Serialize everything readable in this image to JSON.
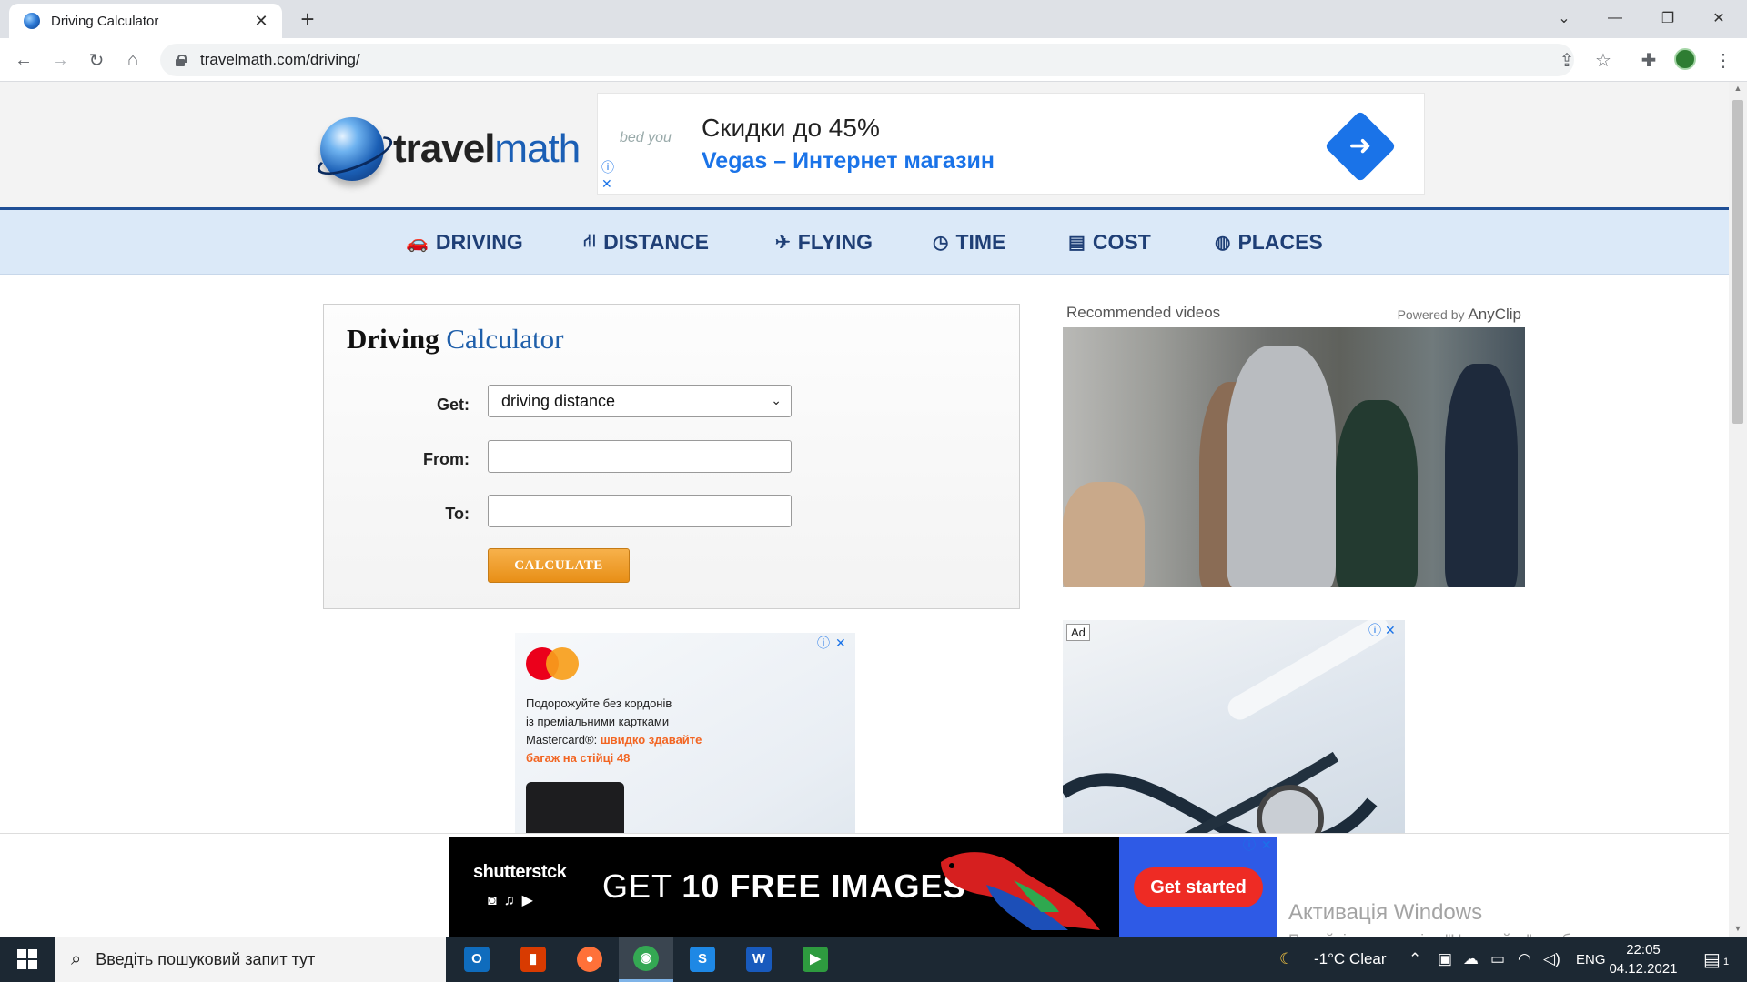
{
  "browser": {
    "tab_title": "Driving Calculator",
    "tab_close": "✕",
    "new_tab": "+",
    "url": "travelmath.com/driving/",
    "window_controls": [
      "⌄",
      "—",
      "❐",
      "✕"
    ]
  },
  "site": {
    "logo_word_bold": "travel",
    "logo_word_light": "math",
    "top_ad": {
      "brand": "bed you",
      "headline": "Скидки до 45%",
      "subline": "Vegas – Интернет магазин",
      "info": "ⓘ",
      "close": "✕"
    },
    "nav": [
      {
        "icon": "car-icon",
        "glyph": "🚗",
        "label": "DRIVING"
      },
      {
        "icon": "road-icon",
        "glyph": "⛙",
        "label": "DISTANCE"
      },
      {
        "icon": "plane-icon",
        "glyph": "✈",
        "label": "FLYING"
      },
      {
        "icon": "clock-icon",
        "glyph": "◷",
        "label": "TIME"
      },
      {
        "icon": "credit-card-icon",
        "glyph": "▤",
        "label": "COST"
      },
      {
        "icon": "globe-icon",
        "glyph": "◍",
        "label": "PLACES"
      }
    ]
  },
  "calculator": {
    "title_bold": "Driving",
    "title_light": "Calculator",
    "get_label": "Get:",
    "get_value": "driving distance",
    "from_label": "From:",
    "from_value": "",
    "to_label": "To:",
    "to_value": "",
    "button": "CALCULATE"
  },
  "videos": {
    "label": "Recommended videos",
    "powered_prefix": "Powered by",
    "powered_brand": "AnyClip"
  },
  "ad_mastercard": {
    "line1": "Подорожуйте без кордонів",
    "line2": "із преміальними картками",
    "line3": "Mastercard®:",
    "line3_orange": "швидко здавайте",
    "line4_orange": "багаж на стійці 48"
  },
  "ad_medical": {
    "tag": "Ad"
  },
  "ad_shutterstock": {
    "brand": "shutterstck",
    "icons": "◙♫▶",
    "headline_pre": "GET",
    "headline_num": "10",
    "headline_post": "FREE IMAGES",
    "cta": "Get started"
  },
  "watermark": {
    "title": "Активація Windows",
    "body": "Перейдіть до розділу \"Настройки\", щоб активувати Windows."
  },
  "taskbar": {
    "search_placeholder": "Введіть пошуковий запит тут",
    "weather": "-1°C  Clear",
    "lang": "ENG",
    "time": "22:05",
    "date": "04.12.2021",
    "notif_count": "1",
    "apps": [
      {
        "name": "outlook-app",
        "letter": "O",
        "color": "#0f6cbd"
      },
      {
        "name": "office-app",
        "letter": "▮",
        "color": "#d83b01"
      },
      {
        "name": "firefox-app",
        "letter": "●",
        "color": "#ff7139"
      },
      {
        "name": "chrome-app",
        "letter": "◉",
        "color": "#34a853"
      },
      {
        "name": "s-app",
        "letter": "S",
        "color": "#1e88e5"
      },
      {
        "name": "word-app",
        "letter": "W",
        "color": "#185abd"
      },
      {
        "name": "media-app",
        "letter": "▶",
        "color": "#2e9b3f"
      }
    ]
  }
}
